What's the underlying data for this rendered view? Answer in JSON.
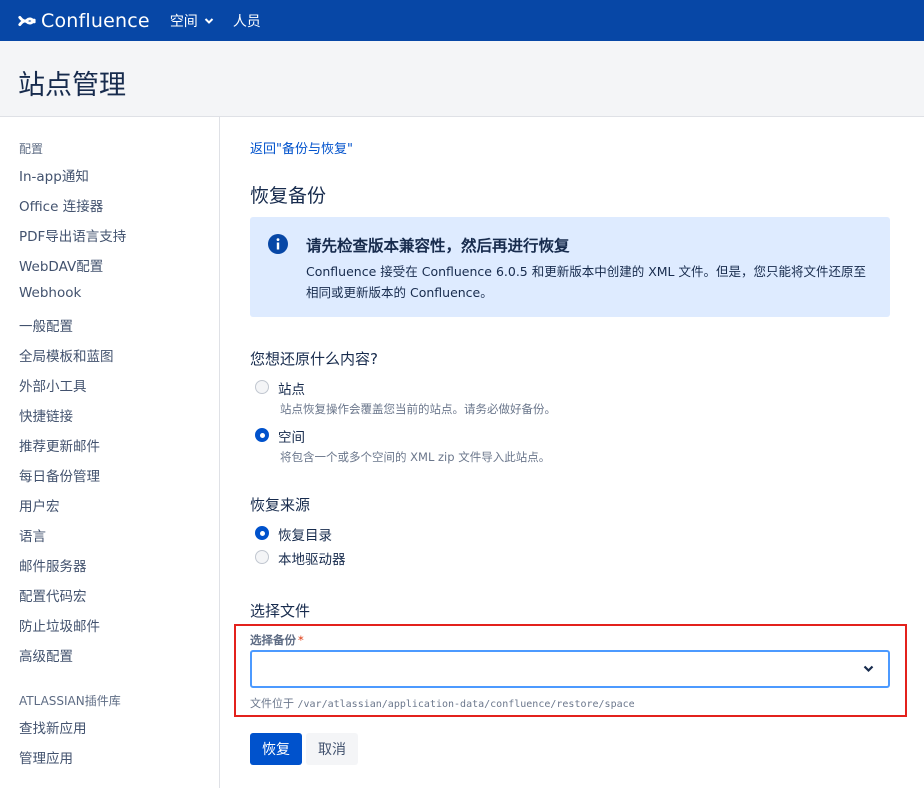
{
  "topbar": {
    "logo_text": "Confluence",
    "nav": [
      {
        "label": "空间"
      },
      {
        "label": "人员"
      }
    ]
  },
  "header": {
    "title": "站点管理"
  },
  "sidebar": {
    "heading_config": "配置",
    "items": [
      "In-app通知",
      "Office 连接器",
      "PDF导出语言支持",
      "WebDAV配置",
      "Webhook",
      "一般配置",
      "全局模板和蓝图",
      "外部小工具",
      "快捷链接",
      "推荐更新邮件",
      "每日备份管理",
      "用户宏",
      "语言",
      "邮件服务器",
      "配置代码宏",
      "防止垃圾邮件",
      "高级配置"
    ],
    "heading_plugins": "ATLASSIAN插件库",
    "plugin_items": [
      "查找新应用",
      "管理应用"
    ]
  },
  "main": {
    "back_link": "返回\"备份与恢复\"",
    "section_title": "恢复备份",
    "info": {
      "title": "请先检查版本兼容性，然后再进行恢复",
      "body": "Confluence 接受在 Confluence 6.0.5 和更新版本中创建的 XML 文件。但是，您只能将文件还原至相同或更新版本的 Confluence。"
    },
    "restore_what": {
      "title": "您想还原什么内容?",
      "options": [
        {
          "label": "站点",
          "desc": "站点恢复操作会覆盖您当前的站点。请务必做好备份。",
          "checked": false
        },
        {
          "label": "空间",
          "desc": "将包含一个或多个空间的 XML zip 文件导入此站点。",
          "checked": true
        }
      ]
    },
    "restore_source": {
      "title": "恢复来源",
      "options": [
        {
          "label": "恢复目录",
          "checked": true
        },
        {
          "label": "本地驱动器",
          "checked": false
        }
      ]
    },
    "choose_file": {
      "title": "选择文件",
      "field_label": "选择备份",
      "required_mark": "*",
      "select_value": "",
      "help_prefix": "文件位于",
      "help_path": "/var/atlassian/application-data/confluence/restore/space"
    },
    "buttons": {
      "restore": "恢复",
      "cancel": "取消"
    }
  },
  "colors": {
    "topbar": "#0747a6",
    "primary": "#0052cc",
    "info_bg": "#deebff",
    "highlight": "#e3211c"
  }
}
